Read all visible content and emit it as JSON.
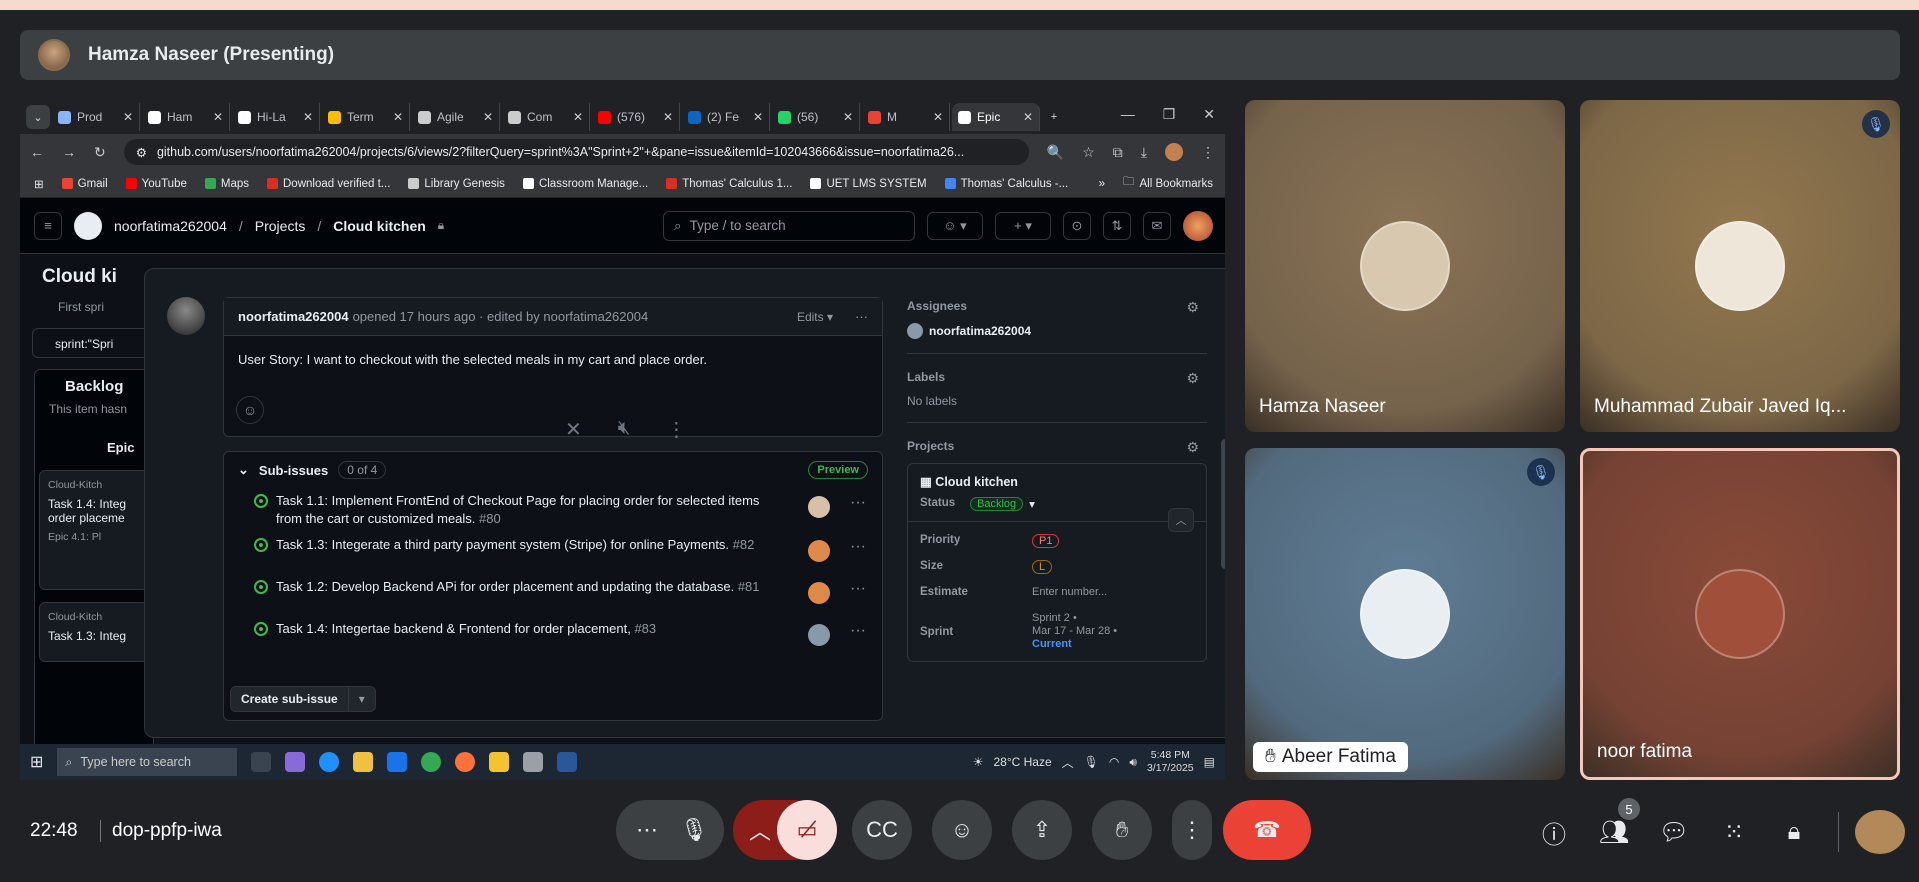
{
  "meeting": {
    "presenter_label": "Hamza Naseer (Presenting)",
    "time": "22:48",
    "code": "dop-ppfp-iwa",
    "participants_count": "5"
  },
  "browser": {
    "tabs": [
      {
        "label": "Prod",
        "icon": "doc-icon",
        "color": "#8ab4f8"
      },
      {
        "label": "Ham",
        "icon": "notion-icon",
        "color": "#ffffff"
      },
      {
        "label": "Hi-La",
        "icon": "notion-icon",
        "color": "#ffffff"
      },
      {
        "label": "Term",
        "icon": "circle-icon",
        "color": "#fbbc04"
      },
      {
        "label": "Agile",
        "icon": "sync-icon",
        "color": "#cccccc"
      },
      {
        "label": "Com",
        "icon": "doc-icon",
        "color": "#cccccc"
      },
      {
        "label": "(576)",
        "icon": "youtube-icon",
        "color": "#ff0000"
      },
      {
        "label": "(2) Fe",
        "icon": "linkedin-icon",
        "color": "#0a66c2"
      },
      {
        "label": "(56)",
        "icon": "whatsapp-icon",
        "color": "#25d366"
      },
      {
        "label": "M",
        "icon": "gmail-icon",
        "color": "#ea4335"
      },
      {
        "label": "Epic",
        "icon": "github-icon",
        "color": "#ffffff"
      }
    ],
    "url": "github.com/users/noorfatima262004/projects/6/views/2?filterQuery=sprint%3A\"Sprint+2\"+&pane=issue&itemId=102043666&issue=noorfatima26...",
    "bookmarks": [
      {
        "label": "Gmail",
        "color": "#ea4335"
      },
      {
        "label": "YouTube",
        "color": "#ff0000"
      },
      {
        "label": "Maps",
        "color": "#34a853"
      },
      {
        "label": "Download verified t...",
        "color": "#d93025"
      },
      {
        "label": "Library Genesis",
        "color": "#cccccc"
      },
      {
        "label": "Classroom Manage...",
        "color": "#ffffff"
      },
      {
        "label": "Thomas' Calculus 1...",
        "color": "#d93025"
      },
      {
        "label": "UET LMS SYSTEM",
        "color": "#ffffff"
      },
      {
        "label": "Thomas' Calculus -...",
        "color": "#4285f4"
      }
    ],
    "all_bookmarks": "All Bookmarks"
  },
  "github": {
    "owner": "noorfatima262004",
    "projects": "Projects",
    "repo": "Cloud kitchen",
    "search_placeholder": "Type / to search",
    "board_title": "Cloud ki",
    "board_tab": "First spri",
    "filter": "sprint:\"Spri",
    "backlog": "Backlog",
    "backlog_sub": "This item hasn",
    "epic": "Epic",
    "card1_repo": "Cloud-Kitch",
    "card1_title": "Task 1.4: Integ order placeme",
    "card1_epic": "Epic 4.1: Pl",
    "card2_repo": "Cloud-Kitch",
    "card2_title": "Task 1.3: Integ"
  },
  "issue": {
    "author": "noorfatima262004",
    "meta": "opened 17 hours ago · edited by noorfatima262004",
    "edits": "Edits",
    "body": "User Story: I want to checkout with the selected meals in my cart and place order.",
    "subissues_title": "Sub-issues",
    "subissues_count": "0 of 4",
    "preview": "Preview",
    "subissues": [
      {
        "title": "Task 1.1: Implement FrontEnd of Checkout Page for placing order for selected items from the cart or customized meals.",
        "num": "#80",
        "avatar": "#d8c0a8"
      },
      {
        "title": "Task 1.3: Integerate a third party payment system (Stripe) for online Payments.",
        "num": "#82",
        "avatar": "#e08a4a"
      },
      {
        "title": "Task 1.2: Develop Backend APi for order placement and updating the database.",
        "num": "#81",
        "avatar": "#e08a4a"
      },
      {
        "title": "Task 1.4: Integertae backend & Frontend for order placement,",
        "num": "#83",
        "avatar": "#8899aa"
      }
    ],
    "create_sub": "Create sub-issue"
  },
  "sidebar": {
    "assignees_label": "Assignees",
    "assignee": "noorfatima262004",
    "labels_label": "Labels",
    "labels_value": "No labels",
    "projects_label": "Projects",
    "project_name": "Cloud kitchen",
    "status_key": "Status",
    "status_value": "Backlog",
    "priority_key": "Priority",
    "priority_value": "P1",
    "size_key": "Size",
    "size_value": "L",
    "estimate_key": "Estimate",
    "estimate_placeholder": "Enter number...",
    "sprint_key": "Sprint",
    "sprint_value": "Sprint 2 •",
    "sprint_dates": "Mar 17 - Mar 28 •",
    "sprint_current": "Current"
  },
  "taskbar": {
    "search": "Type here to search",
    "weather": "28°C  Haze",
    "clock_time": "5:48 PM",
    "clock_date": "3/17/2025"
  },
  "participants": [
    {
      "name": "Hamza Naseer",
      "bg": "#8a7355",
      "muted": false
    },
    {
      "name": "Muhammad Zubair Javed Iq...",
      "bg": "#93784f",
      "muted": true
    },
    {
      "name": "Abeer Fatima",
      "bg": "#5f7c94",
      "muted": true
    },
    {
      "name": "noor fatima",
      "bg": "#8a4a38",
      "muted": false
    }
  ]
}
